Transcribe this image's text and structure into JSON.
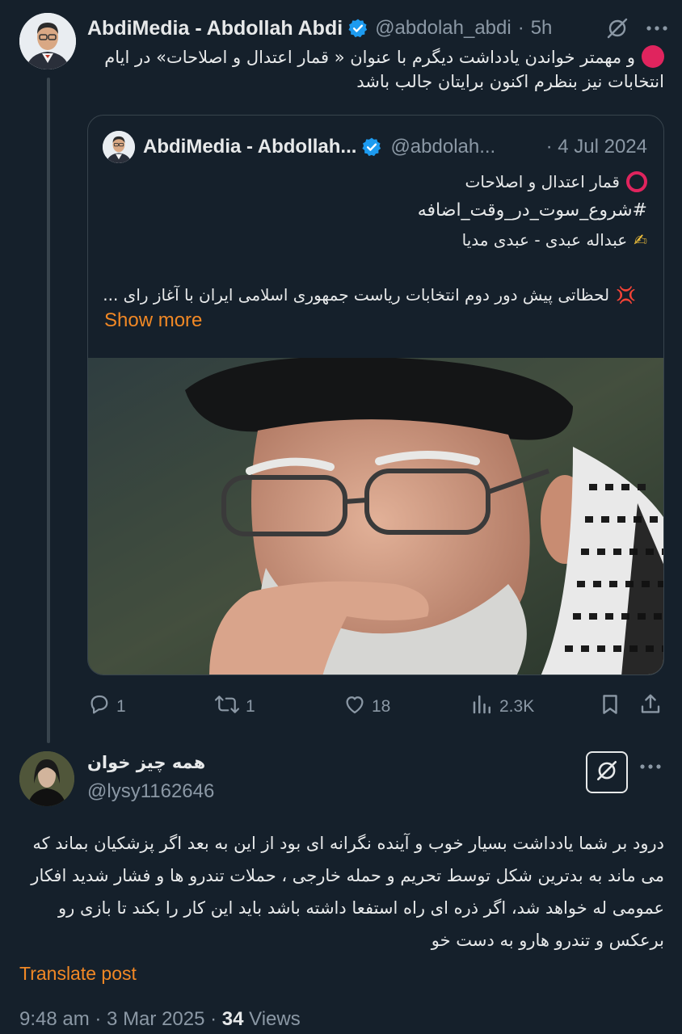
{
  "post": {
    "author_name": "AbdiMedia - Abdollah Abdi",
    "handle": "@abdolah_abdi",
    "separator": "·",
    "time": "5h",
    "text": "و مهمتر خواندن یادداشت دیگرم با عنوان « قمار اعتدال و اصلاحات» در ایام انتخابات نیز بنظرم اکنون برایتان جالب باشد",
    "quote": {
      "author_name": "AbdiMedia - Abdollah...",
      "handle": "@abdolah...",
      "date": "· 4 Jul 2024",
      "line1": "قمار اعتدال و اصلاحات",
      "hashtag": "#شروع_سوت_در_وقت_اضافه",
      "byline": "عبداله عبدی - عبدی مدیا",
      "paragraph": "لحظاتی پیش دور دوم انتخابات ریاست جمهوری اسلامی ایران با آغاز رای ...",
      "show_more": "Show more",
      "emoji_write": "✍",
      "emoji_anger": "💢"
    },
    "actions": {
      "replies": "1",
      "reposts": "1",
      "likes": "18",
      "views": "2.3K"
    }
  },
  "reply": {
    "author_name": "همه چیز خوان",
    "handle": "@lysy1162646",
    "text": "درود بر شما یادداشت بسیار خوب و آینده نگرانه ای بود از این به بعد اگر پزشکیان بماند که می ماند به بدترین شکل توسط تحریم و حمله خارجی ، حملات تندرو ها و فشار شدید افکار عمومی له خواهد شد، اگر ذره ای راه استفعا داشته باشد باید این کار را بکند تا بازی رو برعکس و تندرو هارو به دست خو",
    "translate": "Translate post",
    "timestamp": "9:48 am · 3 Mar 2025 · ",
    "views_count": "34",
    "views_label": " Views"
  },
  "colors": {
    "background": "#15202b",
    "accent_orange": "#f18825",
    "verified_blue": "#1d9bf0",
    "muted": "#8b98a5"
  },
  "icons": [
    "verified-badge-icon",
    "grok-icon",
    "more-icon",
    "reply-icon",
    "repost-icon",
    "like-icon",
    "views-icon",
    "bookmark-icon",
    "share-icon"
  ]
}
